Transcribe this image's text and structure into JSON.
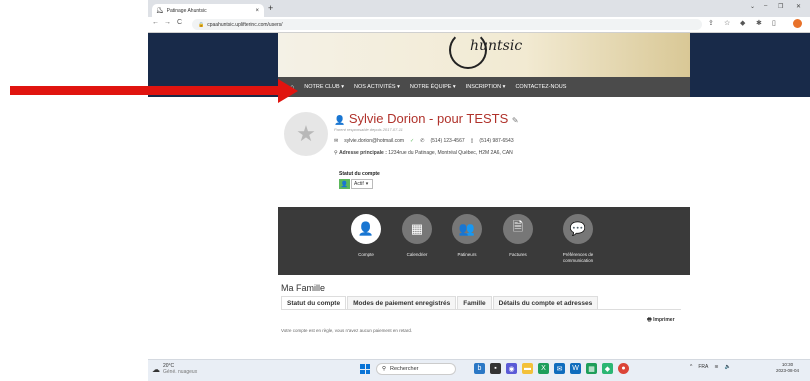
{
  "browser": {
    "tab_title": "Patinage Ahuntsic",
    "tab_close": "×",
    "new_tab": "+",
    "url": "cpaahuntsic.uplifterinc.com/users/",
    "back": "←",
    "forward": "→",
    "reload": "C",
    "win_min": "‒",
    "win_max": "❐",
    "win_close": "✕"
  },
  "site": {
    "logo_text": "huntsic",
    "nav": [
      "NOTRE CLUB ▾",
      "NOS ACTIVITÉS ▾",
      "NOTRE ÉQUIPE ▾",
      "INSCRIPTION ▾",
      "CONTACTEZ-NOUS"
    ]
  },
  "profile": {
    "name": "Sylvie Dorion - pour TESTS",
    "subtitle": "Parent responsable depuis 2017-07-11",
    "email": "sylvie.dorion@hotmail.com",
    "phone1": "(514) 123-4567",
    "phone2": "(514) 987-6543",
    "address_label": "Adresse principale :",
    "address": "1234rue du Patinage, Montréal Québec, H2M 2A6, CAN",
    "status_label": "Statut du compte",
    "status_value": "Actif"
  },
  "panel": {
    "items": [
      {
        "label": "Compte",
        "icon": "👤"
      },
      {
        "label": "Calendrier",
        "icon": "▦"
      },
      {
        "label": "Patineurs",
        "icon": "👥"
      },
      {
        "label": "Factures",
        "icon": "🗎"
      },
      {
        "label": "Préférences de communication",
        "icon": "💬"
      }
    ]
  },
  "family": {
    "title": "Ma Famille",
    "tabs": [
      "Statut du compte",
      "Modes de paiement enregistrés",
      "Famille",
      "Détails du compte et adresses"
    ],
    "print": "Imprimer",
    "message": "Votre compte est en règle, vous n'avez aucun paiement en retard."
  },
  "taskbar": {
    "temp": "20°C",
    "weather": "Géné. nuageux",
    "search": "Rechercher",
    "lang": "FRA",
    "time": "10:30",
    "date": "2023-08-04"
  },
  "colors": {
    "nav_bg": "#4b4b4b",
    "side_bg": "#182a49",
    "name_red": "#b0322b",
    "arrow": "#e0140f",
    "status_green": "#5cb85c"
  }
}
